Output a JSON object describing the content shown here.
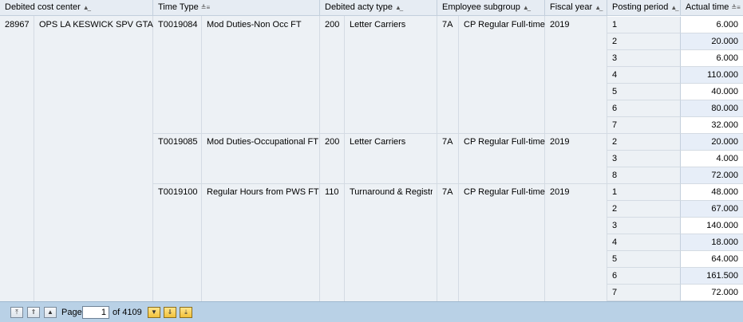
{
  "headers": {
    "cost_center": "Debited cost center",
    "time_type": "Time Type",
    "acty_type": "Debited acty type",
    "emp_subgroup": "Employee subgroup",
    "fiscal_year": "Fiscal year",
    "posting_period": "Posting period",
    "actual_time": "Actual time"
  },
  "cost_center": {
    "code": "28967",
    "name": "OPS LA KESWICK SPV GTA"
  },
  "groups": [
    {
      "time_type_code": "T0019084",
      "time_type_name": "Mod Duties-Non Occ FT",
      "acty_code": "200",
      "acty_name": "Letter Carriers",
      "subgroup_code": "7A",
      "subgroup_name": "CP Regular Full-time",
      "fiscal_year": "2019",
      "rows": [
        {
          "period": "1",
          "actual": "6.000"
        },
        {
          "period": "2",
          "actual": "20.000"
        },
        {
          "period": "3",
          "actual": "6.000"
        },
        {
          "period": "4",
          "actual": "110.000"
        },
        {
          "period": "5",
          "actual": "40.000"
        },
        {
          "period": "6",
          "actual": "80.000"
        },
        {
          "period": "7",
          "actual": "32.000"
        }
      ]
    },
    {
      "time_type_code": "T0019085",
      "time_type_name": "Mod Duties-Occupational FT",
      "acty_code": "200",
      "acty_name": "Letter Carriers",
      "subgroup_code": "7A",
      "subgroup_name": "CP Regular Full-time",
      "fiscal_year": "2019",
      "rows": [
        {
          "period": "2",
          "actual": "20.000"
        },
        {
          "period": "3",
          "actual": "4.000"
        },
        {
          "period": "8",
          "actual": "72.000"
        }
      ]
    },
    {
      "time_type_code": "T0019100",
      "time_type_name": "Regular Hours from PWS FT",
      "acty_code": "110",
      "acty_name": "Turnaround & Registr",
      "subgroup_code": "7A",
      "subgroup_name": "CP Regular Full-time",
      "fiscal_year": "2019",
      "rows": [
        {
          "period": "1",
          "actual": "48.000"
        },
        {
          "period": "2",
          "actual": "67.000"
        },
        {
          "period": "3",
          "actual": "140.000"
        },
        {
          "period": "4",
          "actual": "18.000"
        },
        {
          "period": "5",
          "actual": "64.000"
        },
        {
          "period": "6",
          "actual": "161.500"
        },
        {
          "period": "7",
          "actual": "72.000"
        }
      ]
    }
  ],
  "pager": {
    "page_label": "Page",
    "current_page": "1",
    "of_label": "of 4109"
  }
}
